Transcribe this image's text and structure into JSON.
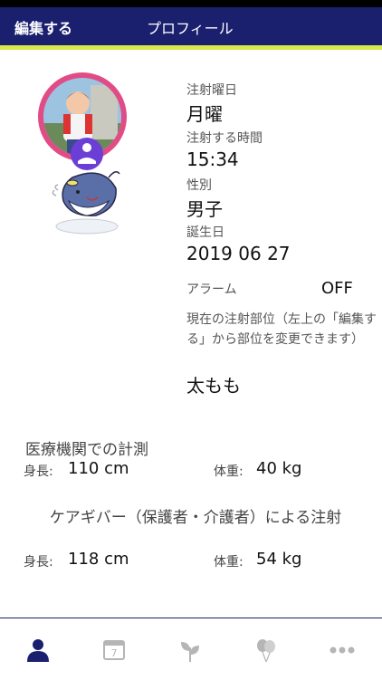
{
  "header": {
    "edit_label": "編集する",
    "title": "プロフィール"
  },
  "profile": {
    "injection_day_label": "注射曜日",
    "injection_day_value": "月曜",
    "injection_time_label": "注射する時間",
    "injection_time_value": "15:34",
    "gender_label": "性別",
    "gender_value": "男子",
    "birthday_label": "誕生日",
    "birthday_value": "2019 06 27",
    "alarm_label": "アラーム",
    "alarm_value": "OFF",
    "site_note": "現在の注射部位（左上の「編集する」から部位を変更できます）",
    "site_value": "太もも"
  },
  "medical": {
    "title": "医療機関での計測",
    "height_label": "身長:",
    "height_value": "110 cm",
    "weight_label": "体重:",
    "weight_value": "40 kg"
  },
  "caregiver": {
    "title": "ケアギバー（保護者・介護者）による注射",
    "height_label": "身長:",
    "height_value": "118 cm",
    "weight_label": "体重:",
    "weight_value": "54 kg"
  },
  "tabs": [
    {
      "icon": "person-icon",
      "active": true
    },
    {
      "icon": "calendar-icon",
      "calendar_day": "7"
    },
    {
      "icon": "sprout-icon"
    },
    {
      "icon": "balloons-icon"
    },
    {
      "icon": "more-icon"
    }
  ],
  "colors": {
    "navbar": "#1a1f6e",
    "accent": "#d6e84a",
    "avatar_ring": "#e24c86",
    "tab_active": "#1a1f6e",
    "tab_inactive": "#b5b5b5"
  }
}
